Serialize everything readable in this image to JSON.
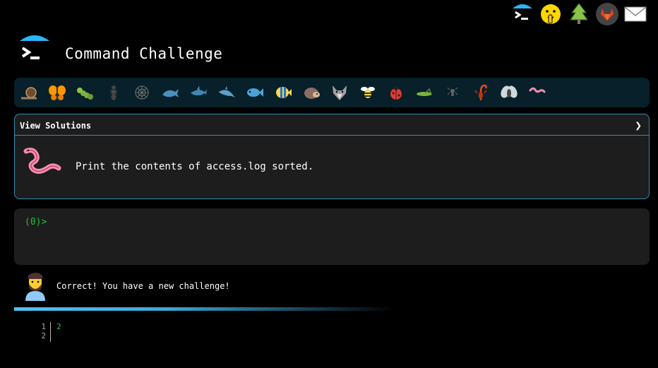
{
  "header": {
    "title": "Command Challenge",
    "logo_icon": "terminal-umbrella-icon"
  },
  "top_icons": [
    {
      "name": "terminal-umbrella-icon"
    },
    {
      "name": "shush-face-icon"
    },
    {
      "name": "tree-icon"
    },
    {
      "name": "gitlab-icon"
    },
    {
      "name": "mail-icon"
    }
  ],
  "animals": [
    "snail",
    "butterfly",
    "caterpillar",
    "ant",
    "spider-web",
    "whale",
    "shark",
    "dolphin",
    "fish",
    "tropical-fish",
    "hedgehog",
    "wolf",
    "bee",
    "ladybug",
    "grasshopper",
    "spider",
    "scorpion",
    "fly",
    "worm"
  ],
  "challenge": {
    "view_solutions": "View Solutions",
    "chevron": "❯",
    "prompt": "Print the contents of access.log sorted."
  },
  "terminal": {
    "prompt": "(0)>"
  },
  "feedback": {
    "message": "Correct! You have a new challenge!",
    "progress": 0.6
  },
  "output": {
    "line_numbers": "1\n2",
    "lines": "2\n"
  },
  "colors": {
    "accent": "#2f8fb3",
    "prompt_green": "#25c03a",
    "panel_bg": "#1d1d1d",
    "bar_bg": "#072029"
  }
}
